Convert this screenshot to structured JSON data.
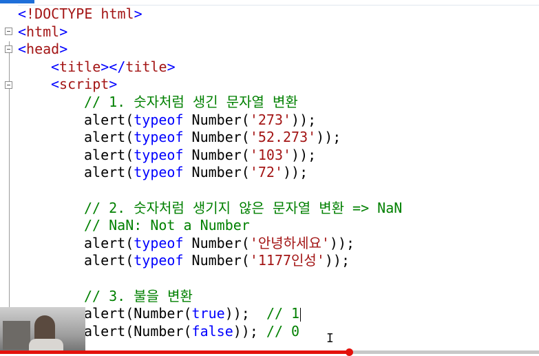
{
  "editor": {
    "lines": [
      {
        "indent": 1,
        "tokens": [
          [
            "punct",
            "<"
          ],
          [
            "tag",
            "!DOCTYPE html"
          ],
          [
            "punct",
            ">"
          ]
        ]
      },
      {
        "indent": 1,
        "tokens": [
          [
            "punct",
            "<"
          ],
          [
            "tag",
            "html"
          ],
          [
            "punct",
            ">"
          ]
        ]
      },
      {
        "indent": 1,
        "tokens": [
          [
            "punct",
            "<"
          ],
          [
            "tag",
            "head"
          ],
          [
            "punct",
            ">"
          ]
        ]
      },
      {
        "indent": 3,
        "tokens": [
          [
            "punct",
            "<"
          ],
          [
            "tag",
            "title"
          ],
          [
            "punct",
            "></"
          ],
          [
            "tag",
            "title"
          ],
          [
            "punct",
            ">"
          ]
        ]
      },
      {
        "indent": 3,
        "tokens": [
          [
            "punct",
            "<"
          ],
          [
            "tag",
            "script"
          ],
          [
            "punct",
            ">"
          ]
        ]
      },
      {
        "indent": 5,
        "tokens": [
          [
            "comment",
            "// 1. 숫자처럼 생긴 문자열 변환"
          ]
        ]
      },
      {
        "indent": 5,
        "tokens": [
          [
            "plain",
            "alert("
          ],
          [
            "keyword",
            "typeof"
          ],
          [
            "plain",
            " Number("
          ],
          [
            "string",
            "'273'"
          ],
          [
            "plain",
            "));"
          ]
        ]
      },
      {
        "indent": 5,
        "tokens": [
          [
            "plain",
            "alert("
          ],
          [
            "keyword",
            "typeof"
          ],
          [
            "plain",
            " Number("
          ],
          [
            "string",
            "'52.273'"
          ],
          [
            "plain",
            "));"
          ]
        ]
      },
      {
        "indent": 5,
        "tokens": [
          [
            "plain",
            "alert("
          ],
          [
            "keyword",
            "typeof"
          ],
          [
            "plain",
            " Number("
          ],
          [
            "string",
            "'103'"
          ],
          [
            "plain",
            "));"
          ]
        ]
      },
      {
        "indent": 5,
        "tokens": [
          [
            "plain",
            "alert("
          ],
          [
            "keyword",
            "typeof"
          ],
          [
            "plain",
            " Number("
          ],
          [
            "string",
            "'72'"
          ],
          [
            "plain",
            "));"
          ]
        ]
      },
      {
        "indent": 5,
        "tokens": []
      },
      {
        "indent": 5,
        "tokens": [
          [
            "comment",
            "// 2. 숫자처럼 생기지 않은 문자열 변환 => NaN"
          ]
        ]
      },
      {
        "indent": 5,
        "tokens": [
          [
            "comment",
            "// NaN: Not a Number"
          ]
        ]
      },
      {
        "indent": 5,
        "tokens": [
          [
            "plain",
            "alert("
          ],
          [
            "keyword",
            "typeof"
          ],
          [
            "plain",
            " Number("
          ],
          [
            "string",
            "'안녕하세요'"
          ],
          [
            "plain",
            "));"
          ]
        ]
      },
      {
        "indent": 5,
        "tokens": [
          [
            "plain",
            "alert("
          ],
          [
            "keyword",
            "typeof"
          ],
          [
            "plain",
            " Number("
          ],
          [
            "string",
            "'1177인성'"
          ],
          [
            "plain",
            "));"
          ]
        ]
      },
      {
        "indent": 5,
        "tokens": []
      },
      {
        "indent": 5,
        "tokens": [
          [
            "comment",
            "// 3. 불을 변환"
          ]
        ]
      },
      {
        "indent": 5,
        "tokens": [
          [
            "plain",
            "alert(Number("
          ],
          [
            "keyword",
            "true"
          ],
          [
            "plain",
            "));  "
          ],
          [
            "comment",
            "// 1"
          ]
        ],
        "cursor": true
      },
      {
        "indent": 5,
        "tokens": [
          [
            "plain",
            "alert(Number("
          ],
          [
            "keyword",
            "false"
          ],
          [
            "plain",
            "));"
          ],
          [
            "comment",
            " // 0"
          ]
        ]
      }
    ]
  },
  "video": {
    "progress": 0.647
  },
  "colors": {
    "tag": "#a31515",
    "punct": "#0000ff",
    "comment": "#008000",
    "keyword": "#0000ff",
    "string": "#a31515",
    "progress": "#e4110b"
  }
}
